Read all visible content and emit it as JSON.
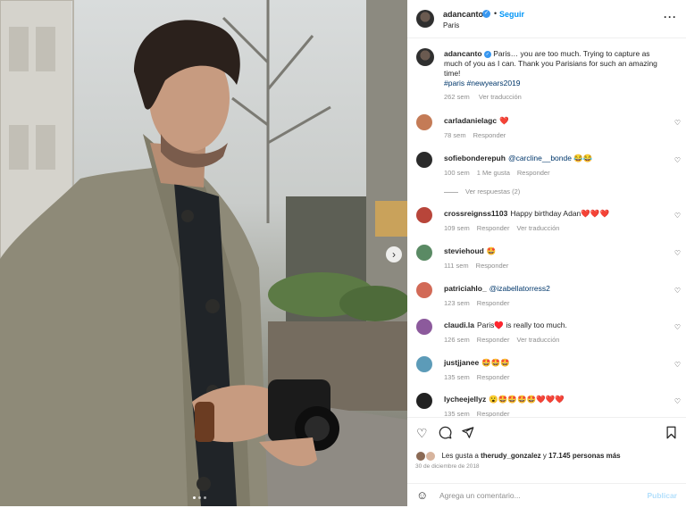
{
  "post": {
    "username": "adancanto",
    "follow_label": "Seguir",
    "location": "Paris",
    "more_icon": "more-options-icon",
    "caption_user": "adancanto",
    "caption_text": "Paris… you are too much. Trying to capture as much of you as I can. Thank you Parisians for such an amazing time!",
    "caption_tags": "#paris #newyears2019",
    "caption_time": "262 sem",
    "caption_translate": "Ver traducción"
  },
  "comments": [
    {
      "user": "carladanielagc",
      "text": "❤️",
      "time": "78 sem",
      "likes": "",
      "reply": "Responder",
      "translate": "",
      "avatar_color": "#c47b56"
    },
    {
      "user": "sofiebonderepuh",
      "mention": "@carcline__bonde",
      "text": "😂😂",
      "time": "100 sem",
      "likes": "1 Me gusta",
      "reply": "Responder",
      "translate": "",
      "avatar_color": "#2b2b2b"
    },
    {
      "user": "crossreignss1103",
      "text": "Happy birthday Adan❤️❤️❤️",
      "time": "109 sem",
      "likes": "",
      "reply": "Responder",
      "translate": "Ver traducción",
      "avatar_color": "#b8453a"
    },
    {
      "user": "steviehoud",
      "text": "🤩",
      "time": "111 sem",
      "likes": "",
      "reply": "Responder",
      "translate": "",
      "avatar_color": "#5a8a64"
    },
    {
      "user": "patriciahlo_",
      "mention": "@izabellatorress2",
      "text": "",
      "time": "123 sem",
      "likes": "",
      "reply": "Responder",
      "translate": "",
      "avatar_color": "#d26a57"
    },
    {
      "user": "claudi.la",
      "text": "Paris♥️ is really too much.",
      "time": "126 sem",
      "likes": "",
      "reply": "Responder",
      "translate": "Ver traducción",
      "avatar_color": "#8c5a9c"
    },
    {
      "user": "justjjanee",
      "text": "🤩🤩🤩",
      "time": "135 sem",
      "likes": "",
      "reply": "Responder",
      "translate": "",
      "avatar_color": "#5c9bb8"
    },
    {
      "user": "lycheejellyz",
      "text": "😮🤩🤩🤩🤩❤️❤️❤️",
      "time": "135 sem",
      "likes": "",
      "reply": "Responder",
      "translate": "",
      "avatar_color": "#222222"
    }
  ],
  "view_replies": "Ver respuestas (2)",
  "likes_text_pre": "Les gusta a",
  "likes_user": "therudy_gonzalez",
  "likes_and": "y",
  "likes_count": "17.145 personas más",
  "date": "30 de diciembre de 2018",
  "add_comment": {
    "placeholder": "Agrega un comentario...",
    "post_label": "Publicar"
  },
  "icons": {
    "like": "heart-icon",
    "comment": "comment-icon",
    "share": "share-icon",
    "save": "bookmark-icon",
    "emoji": "emoji-icon"
  },
  "colors": {
    "accent": "#0095f6",
    "verified": "#3897f0",
    "muted": "#8e8e8e",
    "link": "#00376b"
  }
}
